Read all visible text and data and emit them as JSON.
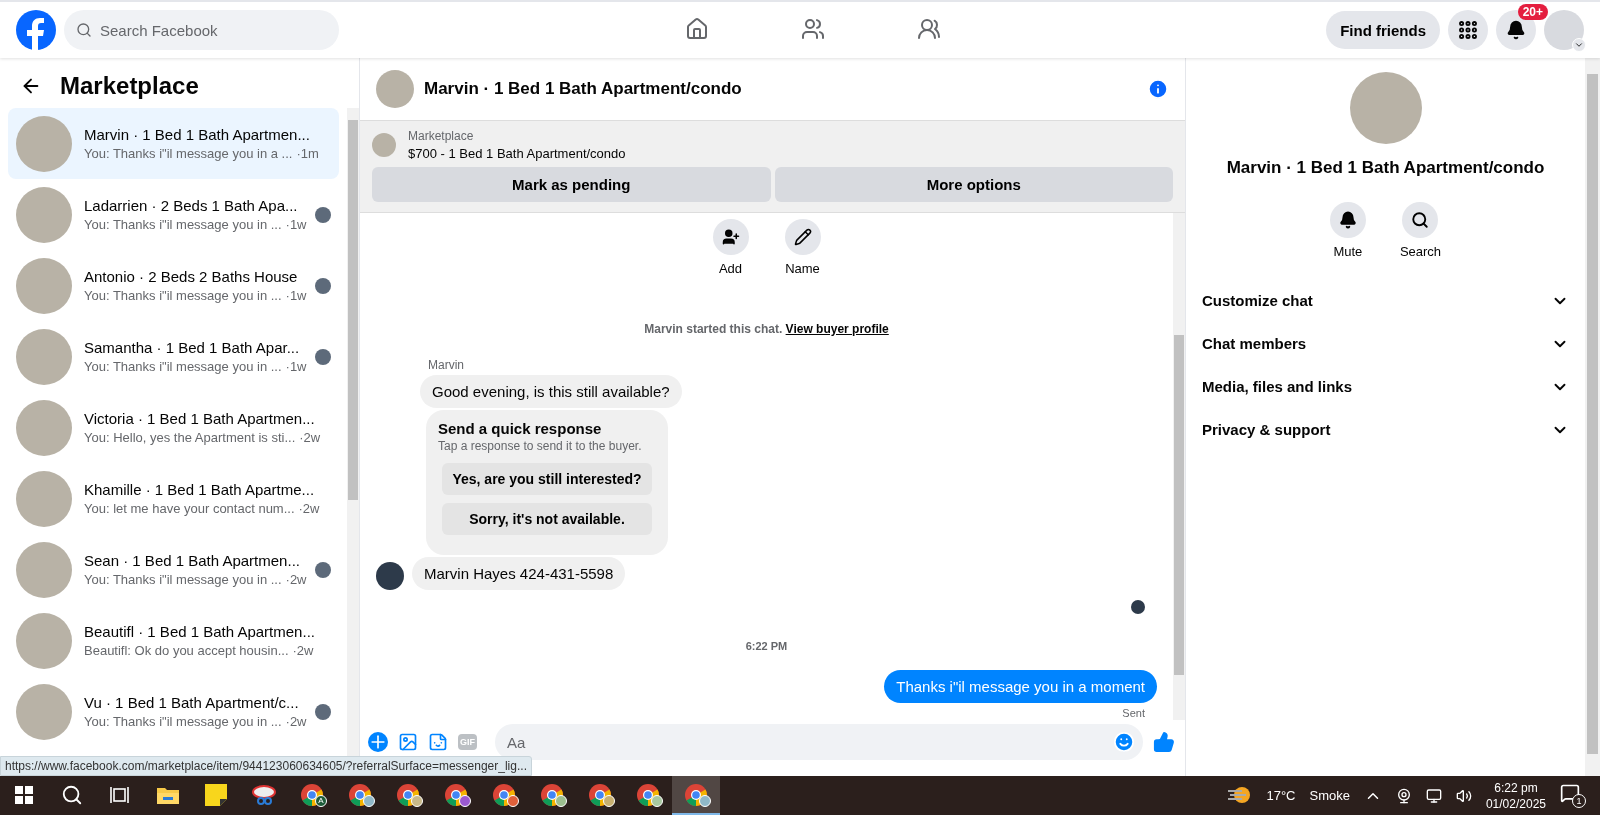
{
  "nav": {
    "search": {
      "placeholder": "Search Facebook"
    },
    "tabs": [
      {
        "kind": "home",
        "selected": false
      },
      {
        "kind": "friends",
        "selected": false
      },
      {
        "kind": "groups",
        "selected": false
      }
    ],
    "find_friends": "Find friends",
    "notifications_badge": "20+"
  },
  "sidebar": {
    "title": "Marketplace",
    "items": [
      {
        "name": "Marvin · 1 Bed 1 Bath Apartmen...",
        "preview": "You: Thanks i\"il message you in a ...",
        "time": "·1m",
        "selected": true,
        "seen": false
      },
      {
        "name": "Ladarrien · 2 Beds 1 Bath Apa...",
        "preview": "You: Thanks i\"il message you in ...",
        "time": "·1w",
        "selected": false,
        "seen": true
      },
      {
        "name": "Antonio · 2 Beds 2 Baths House",
        "preview": "You: Thanks i\"il message you in ...",
        "time": "·1w",
        "selected": false,
        "seen": true
      },
      {
        "name": "Samantha · 1 Bed 1 Bath Apar...",
        "preview": "You: Thanks i\"il message you in ...",
        "time": "·1w",
        "selected": false,
        "seen": true
      },
      {
        "name": "Victoria · 1 Bed 1 Bath Apartmen...",
        "preview": "You: Hello, yes the Apartment is sti...",
        "time": "·2w",
        "selected": false,
        "seen": false
      },
      {
        "name": "Khamille · 1 Bed 1 Bath Apartme...",
        "preview": "You: let me have your contact num...",
        "time": "·2w",
        "selected": false,
        "seen": false
      },
      {
        "name": "Sean · 1 Bed 1 Bath Apartmen...",
        "preview": "You: Thanks i\"il message you in ...",
        "time": "·2w",
        "selected": false,
        "seen": true
      },
      {
        "name": "Beautifl · 1 Bed 1 Bath Apartmen...",
        "preview": "Beautifl: Ok do you accept housin...",
        "time": "·2w",
        "selected": false,
        "seen": false
      },
      {
        "name": "Vu · 1 Bed 1 Bath Apartment/c...",
        "preview": "You: Thanks i\"il message you in ...",
        "time": "·2w",
        "selected": false,
        "seen": true
      }
    ]
  },
  "chat": {
    "title": "Marvin · 1 Bed 1 Bath Apartment/condo",
    "listing": {
      "label": "Marketplace",
      "item": "$700 - 1 Bed 1 Bath Apartment/condo",
      "buttons": [
        "Mark as pending",
        "More options"
      ]
    },
    "actions": [
      {
        "kind": "add",
        "label": "Add"
      },
      {
        "kind": "name",
        "label": "Name"
      }
    ],
    "messages": [
      {
        "kind": "started",
        "text": "Marvin started this chat.",
        "link": "View buyer profile"
      },
      {
        "kind": "sender",
        "text": "Marvin"
      },
      {
        "kind": "incoming",
        "text": "Good evening, is this still available?",
        "avatar": false
      },
      {
        "kind": "quick",
        "title": "Send a quick response",
        "subtitle": "Tap a response to send it to the buyer.",
        "options": [
          "Yes, are you still interested?",
          "Sorry, it's not available."
        ]
      },
      {
        "kind": "incoming",
        "text": "Marvin Hayes 424-431-5598",
        "avatar": true
      },
      {
        "kind": "seen"
      },
      {
        "kind": "time",
        "text": "6:22 PM"
      },
      {
        "kind": "outgoing",
        "text": "Thanks i\"il message you in a moment"
      },
      {
        "kind": "status",
        "text": "Sent"
      }
    ],
    "composer": {
      "placeholder": "Aa",
      "gif": "GIF"
    }
  },
  "details": {
    "title": "Marvin · 1 Bed 1 Bath Apartment/condo",
    "actions": [
      {
        "kind": "mute",
        "label": "Mute"
      },
      {
        "kind": "search",
        "label": "Search"
      }
    ],
    "sections": [
      {
        "label": "Customize chat",
        "expanded": false
      },
      {
        "label": "Chat members",
        "expanded": false
      },
      {
        "label": "Media, files and links",
        "expanded": false
      },
      {
        "label": "Privacy & support",
        "expanded": false
      }
    ]
  },
  "status_url": "https://www.facebook.com/marketplace/item/944123060634605/?referralSurface=messenger_lig...",
  "taskbar": {
    "apps": [
      {
        "kind": "explorer",
        "selected": false
      },
      {
        "kind": "sticky",
        "selected": false
      },
      {
        "kind": "snip",
        "selected": false
      },
      {
        "kind": "chrome",
        "badge": "A",
        "color": "#1e5c3a",
        "selected": false
      },
      {
        "kind": "chrome",
        "color": "#8fb8c8",
        "selected": false
      },
      {
        "kind": "chrome",
        "color": "#c9b98a",
        "selected": false
      },
      {
        "kind": "chrome",
        "color": "#9b59d0",
        "selected": false
      },
      {
        "kind": "chrome",
        "color": "#e0603a",
        "selected": false
      },
      {
        "kind": "chrome",
        "color": "#9cbf8f",
        "selected": false
      },
      {
        "kind": "chrome",
        "color": "#c8b070",
        "selected": false
      },
      {
        "kind": "chrome",
        "color": "#a8c8a0",
        "selected": false
      },
      {
        "kind": "chrome",
        "color": "#8fb8c8",
        "selected": true
      }
    ],
    "temperature": "17°C",
    "weather": "Smoke",
    "time": "6:22 pm",
    "date": "01/02/2025",
    "notifications": "1"
  }
}
